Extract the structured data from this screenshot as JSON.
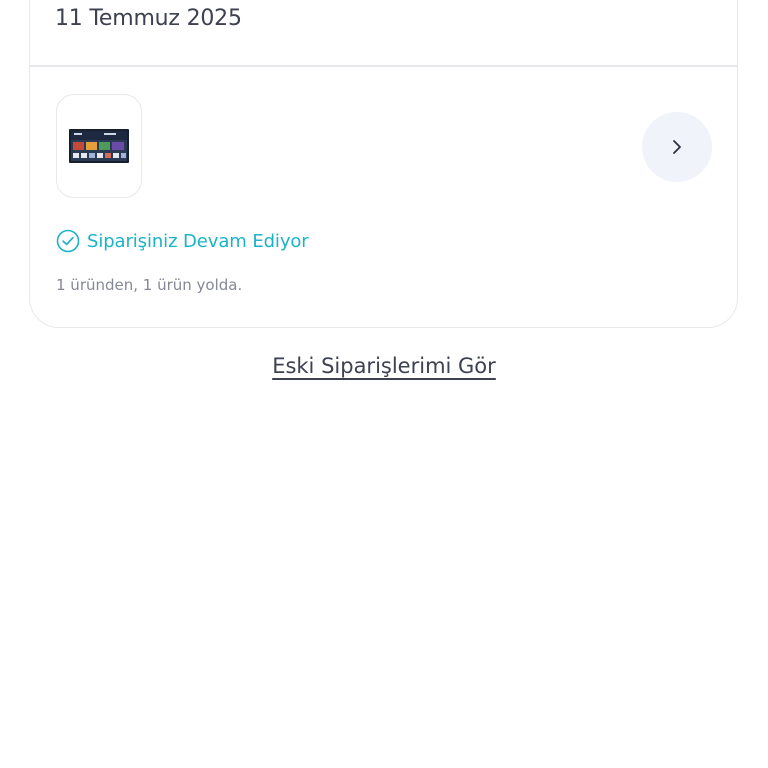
{
  "order": {
    "date": "11 Temmuz 2025",
    "product_image_icon": "tv-product-icon",
    "detail_icon": "chevron-right-icon",
    "status_icon": "check-circle-icon",
    "status_text": "Siparişiniz Devam Ediyor",
    "delivery_summary": "1 üründen, 1 ürün yolda.",
    "status_color": "#1bb3c7"
  },
  "links": {
    "old_orders": "Eski Siparişlerimi Gör"
  }
}
